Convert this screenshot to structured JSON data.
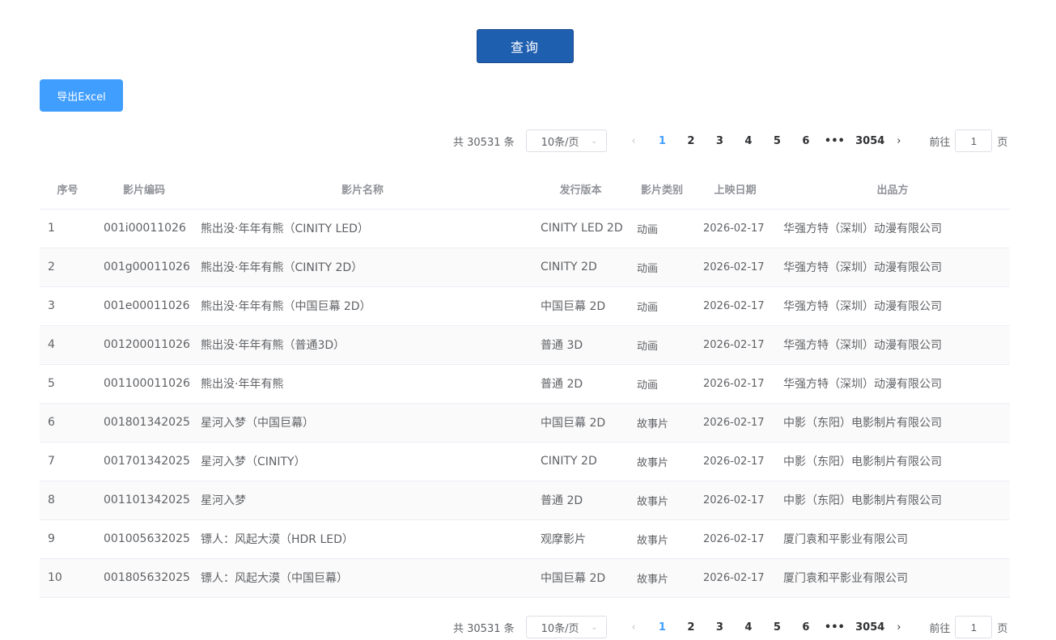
{
  "query_label": "查询",
  "export_label": "导出Excel",
  "pagination": {
    "total": "共 30531 条",
    "page_size": "10条/页",
    "pages": [
      "1",
      "2",
      "3",
      "4",
      "5",
      "6"
    ],
    "ellipsis": "•••",
    "last": "3054",
    "goto_label": "前往",
    "goto_value": "1",
    "page_suffix": "页",
    "prev": "‹",
    "next": "›"
  },
  "table": {
    "headers": [
      "序号",
      "影片编码",
      "影片名称",
      "发行版本",
      "影片类别",
      "上映日期",
      "出品方"
    ],
    "rows": [
      [
        "1",
        "001i00011026",
        "熊出没·年年有熊（CINITY LED）",
        "CINITY LED 2D",
        "动画",
        "2026-02-17",
        "华强方特（深圳）动漫有限公司"
      ],
      [
        "2",
        "001g00011026",
        "熊出没·年年有熊（CINITY 2D）",
        "CINITY 2D",
        "动画",
        "2026-02-17",
        "华强方特（深圳）动漫有限公司"
      ],
      [
        "3",
        "001e00011026",
        "熊出没·年年有熊（中国巨幕 2D）",
        "中国巨幕 2D",
        "动画",
        "2026-02-17",
        "华强方特（深圳）动漫有限公司"
      ],
      [
        "4",
        "001200011026",
        "熊出没·年年有熊（普通3D）",
        "普通 3D",
        "动画",
        "2026-02-17",
        "华强方特（深圳）动漫有限公司"
      ],
      [
        "5",
        "001100011026",
        "熊出没·年年有熊",
        "普通 2D",
        "动画",
        "2026-02-17",
        "华强方特（深圳）动漫有限公司"
      ],
      [
        "6",
        "001801342025",
        "星河入梦（中国巨幕）",
        "中国巨幕 2D",
        "故事片",
        "2026-02-17",
        "中影（东阳）电影制片有限公司"
      ],
      [
        "7",
        "001701342025",
        "星河入梦（CINITY）",
        "CINITY 2D",
        "故事片",
        "2026-02-17",
        "中影（东阳）电影制片有限公司"
      ],
      [
        "8",
        "001101342025",
        "星河入梦",
        "普通 2D",
        "故事片",
        "2026-02-17",
        "中影（东阳）电影制片有限公司"
      ],
      [
        "9",
        "001005632025",
        "镖人：风起大漠（HDR LED）",
        "观摩影片",
        "故事片",
        "2026-02-17",
        "厦门袁和平影业有限公司"
      ],
      [
        "10",
        "001805632025",
        "镖人：风起大漠（中国巨幕）",
        "中国巨幕 2D",
        "故事片",
        "2026-02-17",
        "厦门袁和平影业有限公司"
      ]
    ]
  }
}
